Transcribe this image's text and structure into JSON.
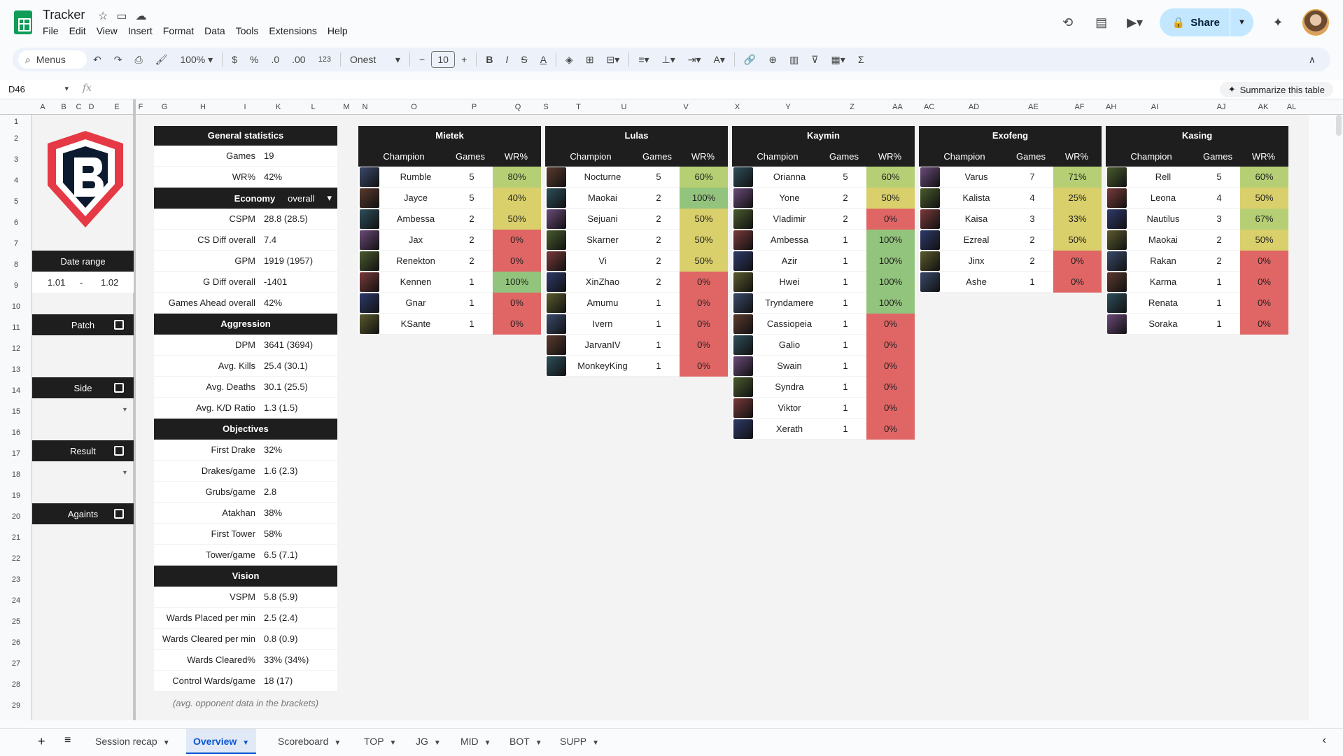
{
  "app": {
    "title": "Tracker"
  },
  "menu": [
    "File",
    "Edit",
    "View",
    "Insert",
    "Format",
    "Data",
    "Tools",
    "Extensions",
    "Help"
  ],
  "share_label": "Share",
  "toolbar": {
    "menus_label": "Menus",
    "zoom": "100%",
    "currency": "$",
    "percent": "%",
    "dec_dec": ".0",
    "inc_dec": ".00",
    "format123": "123",
    "font": "Onest",
    "font_size": "10"
  },
  "formula": {
    "cell_ref": "D46",
    "fx": "fx",
    "summarize": "Summarize this table"
  },
  "columns": [
    "A",
    "B",
    "C",
    "D",
    "E",
    "F",
    "G",
    "H",
    "I",
    "K",
    "L",
    "M",
    "N",
    "O",
    "P",
    "Q",
    "S",
    "T",
    "U",
    "V",
    "X",
    "Y",
    "Z",
    "AA",
    "AC",
    "AD",
    "AE",
    "AF",
    "AH",
    "AI",
    "AJ",
    "AK",
    "AL"
  ],
  "rows": [
    "1",
    "2",
    "3",
    "4",
    "5",
    "6",
    "7",
    "8",
    "9",
    "10",
    "11",
    "12",
    "13",
    "14",
    "15",
    "16",
    "17",
    "18",
    "19",
    "20",
    "21",
    "22",
    "23",
    "24",
    "25",
    "26",
    "27",
    "28",
    "29"
  ],
  "sidebar": {
    "date_range_label": "Date range",
    "date_from": "1.01",
    "date_sep": "-",
    "date_to": "1.02",
    "patch": "Patch",
    "side": "Side",
    "result": "Result",
    "against": "Againts"
  },
  "general": {
    "title": "General statistics",
    "top": [
      {
        "k": "Games",
        "v": "19"
      },
      {
        "k": "WR%",
        "v": "42%"
      }
    ],
    "economy_label": "Economy",
    "economy_select": "overall",
    "economy": [
      {
        "k": "CSPM",
        "v": "28.8 (28.5)"
      },
      {
        "k": "CS Diff overall",
        "v": "7.4"
      },
      {
        "k": "GPM",
        "v": "1919 (1957)"
      },
      {
        "k": "G Diff overall",
        "v": "-1401"
      },
      {
        "k": "Games Ahead overall",
        "v": "42%"
      }
    ],
    "aggression_label": "Aggression",
    "aggression": [
      {
        "k": "DPM",
        "v": "3641 (3694)"
      },
      {
        "k": "Avg. Kills",
        "v": "25.4 (30.1)"
      },
      {
        "k": "Avg. Deaths",
        "v": "30.1 (25.5)"
      },
      {
        "k": "Avg. K/D Ratio",
        "v": "1.3 (1.5)"
      }
    ],
    "objectives_label": "Objectives",
    "objectives": [
      {
        "k": "First Drake",
        "v": "32%"
      },
      {
        "k": "Drakes/game",
        "v": "1.6 (2.3)"
      },
      {
        "k": "Grubs/game",
        "v": "2.8"
      },
      {
        "k": "Atakhan",
        "v": "38%"
      },
      {
        "k": "First Tower",
        "v": "58%"
      },
      {
        "k": "Tower/game",
        "v": "6.5 (7.1)"
      }
    ],
    "vision_label": "Vision",
    "vision": [
      {
        "k": "VSPM",
        "v": "5.8 (5.9)"
      },
      {
        "k": "Wards Placed per min",
        "v": "2.5 (2.4)"
      },
      {
        "k": "Wards Cleared per min",
        "v": "0.8 (0.9)"
      },
      {
        "k": "Wards Cleared%",
        "v": "33% (34%)"
      },
      {
        "k": "Control Wards/game",
        "v": "18 (17)"
      }
    ],
    "footnote": "(avg. opponent data in the brackets)"
  },
  "col_headers": {
    "champion": "Champion",
    "games": "Games",
    "wr": "WR%"
  },
  "players": [
    {
      "name": "Mietek",
      "champs": [
        [
          "Rumble",
          "5",
          "80%"
        ],
        [
          "Jayce",
          "5",
          "40%"
        ],
        [
          "Ambessa",
          "2",
          "50%"
        ],
        [
          "Jax",
          "2",
          "0%"
        ],
        [
          "Renekton",
          "2",
          "0%"
        ],
        [
          "Kennen",
          "1",
          "100%"
        ],
        [
          "Gnar",
          "1",
          "0%"
        ],
        [
          "KSante",
          "1",
          "0%"
        ]
      ]
    },
    {
      "name": "Lulas",
      "champs": [
        [
          "Nocturne",
          "5",
          "60%"
        ],
        [
          "Maokai",
          "2",
          "100%"
        ],
        [
          "Sejuani",
          "2",
          "50%"
        ],
        [
          "Skarner",
          "2",
          "50%"
        ],
        [
          "Vi",
          "2",
          "50%"
        ],
        [
          "XinZhao",
          "2",
          "0%"
        ],
        [
          "Amumu",
          "1",
          "0%"
        ],
        [
          "Ivern",
          "1",
          "0%"
        ],
        [
          "JarvanIV",
          "1",
          "0%"
        ],
        [
          "MonkeyKing",
          "1",
          "0%"
        ]
      ]
    },
    {
      "name": "Kaymin",
      "champs": [
        [
          "Orianna",
          "5",
          "60%"
        ],
        [
          "Yone",
          "2",
          "50%"
        ],
        [
          "Vladimir",
          "2",
          "0%"
        ],
        [
          "Ambessa",
          "1",
          "100%"
        ],
        [
          "Azir",
          "1",
          "100%"
        ],
        [
          "Hwei",
          "1",
          "100%"
        ],
        [
          "Tryndamere",
          "1",
          "100%"
        ],
        [
          "Cassiopeia",
          "1",
          "0%"
        ],
        [
          "Galio",
          "1",
          "0%"
        ],
        [
          "Swain",
          "1",
          "0%"
        ],
        [
          "Syndra",
          "1",
          "0%"
        ],
        [
          "Viktor",
          "1",
          "0%"
        ],
        [
          "Xerath",
          "1",
          "0%"
        ]
      ]
    },
    {
      "name": "Exofeng",
      "champs": [
        [
          "Varus",
          "7",
          "71%"
        ],
        [
          "Kalista",
          "4",
          "25%"
        ],
        [
          "Kaisa",
          "3",
          "33%"
        ],
        [
          "Ezreal",
          "2",
          "50%"
        ],
        [
          "Jinx",
          "2",
          "0%"
        ],
        [
          "Ashe",
          "1",
          "0%"
        ]
      ]
    },
    {
      "name": "Kasing",
      "champs": [
        [
          "Rell",
          "5",
          "60%"
        ],
        [
          "Leona",
          "4",
          "50%"
        ],
        [
          "Nautilus",
          "3",
          "67%"
        ],
        [
          "Maokai",
          "2",
          "50%"
        ],
        [
          "Rakan",
          "2",
          "0%"
        ],
        [
          "Karma",
          "1",
          "0%"
        ],
        [
          "Renata",
          "1",
          "0%"
        ],
        [
          "Soraka",
          "1",
          "0%"
        ]
      ]
    }
  ],
  "tabs": [
    "Session recap",
    "Overview",
    "Scoreboard",
    "TOP",
    "JG",
    "MID",
    "BOT",
    "SUPP"
  ],
  "colors": {
    "green": "#93c47d",
    "yellow": "#d9cf6b",
    "lightgreen": "#b6cf74",
    "red": "#e06666",
    "header": "#1e1e1e"
  }
}
